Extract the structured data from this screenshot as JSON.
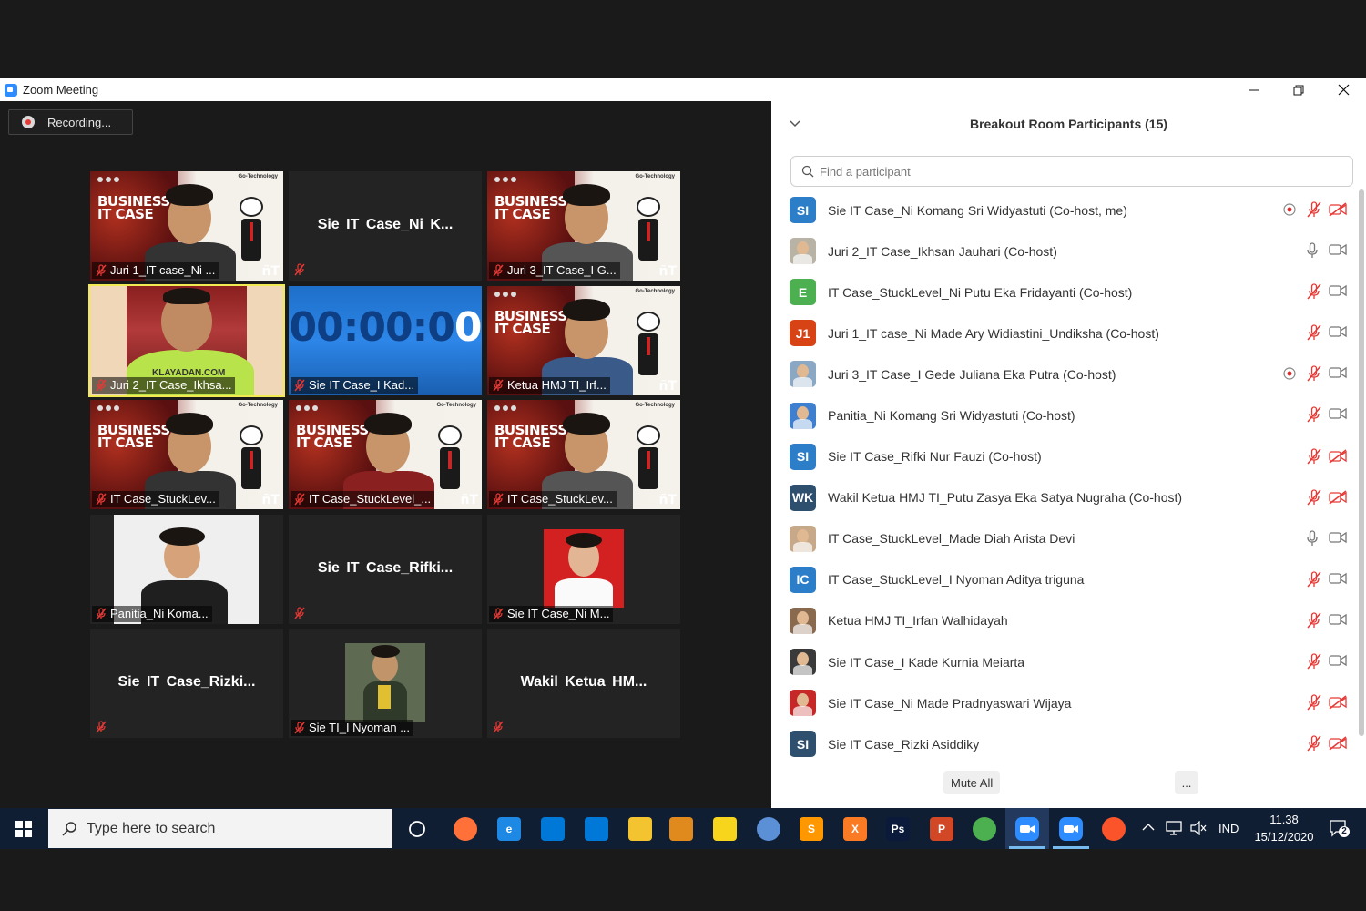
{
  "window": {
    "title": "Zoom Meeting",
    "minimize_icon": "minimize-icon",
    "restore_icon": "restore-icon",
    "close_icon": "close-icon"
  },
  "recording": {
    "label": "Recording..."
  },
  "video_tiles": [
    {
      "name": "Juri 1_IT case_Ni ...",
      "type": "business"
    },
    {
      "name": "Sie IT Case_Ni K...",
      "type": "plain"
    },
    {
      "name": "Juri 3_IT Case_I G...",
      "type": "business"
    },
    {
      "name": "Juri 2_IT Case_Ikhsa...",
      "type": "green",
      "active": true,
      "shirt_text": "KLAYADAN.COM"
    },
    {
      "name": "Sie IT Case_I Kad...",
      "type": "timer",
      "timer": "00:00:00"
    },
    {
      "name": "Ketua HMJ TI_Irf...",
      "type": "business"
    },
    {
      "name": "IT Case_StuckLev...",
      "type": "business"
    },
    {
      "name": "IT Case_StuckLevel_...",
      "type": "business"
    },
    {
      "name": "IT Case_StuckLev...",
      "type": "business"
    },
    {
      "name": "Panitia_Ni Koma...",
      "type": "photo"
    },
    {
      "name": "Sie IT Case_Rifki...",
      "type": "plain"
    },
    {
      "name": "Sie IT Case_Ni M...",
      "type": "photo"
    },
    {
      "name": "Sie IT Case_Rizki...",
      "type": "plain"
    },
    {
      "name": "Sie TI_I Nyoman ...",
      "type": "photo"
    },
    {
      "name": "Wakil Ketua HM...",
      "type": "plain"
    }
  ],
  "business_banner": {
    "line1": "BUSINESS",
    "line2": "IT CASE",
    "tagline": "Go-Technology",
    "brand": "ñT"
  },
  "panel": {
    "title": "Breakout Room Participants (15)",
    "search_placeholder": "Find a participant",
    "participants": [
      {
        "initials": "SI",
        "name": "Sie IT Case_Ni Komang Sri Widyastuti (Co-host, me)",
        "color": "#2d7ec9",
        "record": true,
        "mic": "muted",
        "video": "off"
      },
      {
        "initials": "",
        "name": "Juri 2_IT Case_Ikhsan Jauhari (Co-host)",
        "color": "#b9b3a6",
        "record": false,
        "mic": "on",
        "video": "on"
      },
      {
        "initials": "E",
        "name": "IT Case_StuckLevel_Ni Putu Eka Fridayanti (Co-host)",
        "color": "#4caf50",
        "record": false,
        "mic": "muted",
        "video": "on"
      },
      {
        "initials": "J1",
        "name": "Juri 1_IT case_Ni Made Ary Widiastini_Undiksha (Co-host)",
        "color": "#d84315",
        "record": false,
        "mic": "muted",
        "video": "on"
      },
      {
        "initials": "",
        "name": "Juri 3_IT Case_I Gede Juliana Eka Putra (Co-host)",
        "color": "#8aa7c4",
        "record": true,
        "mic": "muted",
        "video": "on"
      },
      {
        "initials": "",
        "name": "Panitia_Ni Komang Sri Widyastuti (Co-host)",
        "color": "#3f7fd0",
        "record": false,
        "mic": "muted",
        "video": "on"
      },
      {
        "initials": "SI",
        "name": "Sie IT Case_Rifki Nur Fauzi (Co-host)",
        "color": "#2d7ec9",
        "record": false,
        "mic": "muted",
        "video": "off"
      },
      {
        "initials": "WK",
        "name": "Wakil Ketua HMJ TI_Putu Zasya Eka Satya Nugraha (Co-host)",
        "color": "#2f4f6f",
        "record": false,
        "mic": "muted",
        "video": "off"
      },
      {
        "initials": "",
        "name": "IT Case_StuckLevel_Made Diah Arista Devi",
        "color": "#c7a98a",
        "record": false,
        "mic": "on",
        "video": "on"
      },
      {
        "initials": "IC",
        "name": "IT Case_StuckLevel_I Nyoman Aditya triguna",
        "color": "#2d7ec9",
        "record": false,
        "mic": "muted",
        "video": "on"
      },
      {
        "initials": "",
        "name": "Ketua HMJ TI_Irfan Walhidayah",
        "color": "#8a6a4f",
        "record": false,
        "mic": "muted",
        "video": "on"
      },
      {
        "initials": "",
        "name": "Sie IT Case_I Kade Kurnia Meiarta",
        "color": "#3a3a3a",
        "record": false,
        "mic": "muted",
        "video": "on"
      },
      {
        "initials": "",
        "name": "Sie IT Case_Ni Made Pradnyaswari Wijaya",
        "color": "#c62828",
        "record": false,
        "mic": "muted",
        "video": "off"
      },
      {
        "initials": "SI",
        "name": "Sie IT Case_Rizki Asiddiky",
        "color": "#2f4f6f",
        "record": false,
        "mic": "muted",
        "video": "off"
      }
    ],
    "mute_all_label": "Mute All",
    "more_label": "..."
  },
  "taskbar": {
    "search_placeholder": "Type here to search",
    "apps": [
      {
        "icon": "task-view-icon",
        "label": "",
        "color": "#101e33"
      },
      {
        "icon": "firefox-icon",
        "label": "",
        "color": "#ff7139"
      },
      {
        "icon": "edge-icon",
        "label": "e",
        "color": "#1e88e5"
      },
      {
        "icon": "store-icon",
        "label": "",
        "color": "#0078d7"
      },
      {
        "icon": "mail-icon",
        "label": "",
        "color": "#0078d7"
      },
      {
        "icon": "file-explorer-icon",
        "label": "",
        "color": "#f4c430"
      },
      {
        "icon": "video-player-icon",
        "label": "",
        "color": "#e08a1e"
      },
      {
        "icon": "sticky-notes-icon",
        "label": "",
        "color": "#f7d51d"
      },
      {
        "icon": "chromium-icon",
        "label": "",
        "color": "#5b8fd6"
      },
      {
        "icon": "sublime-icon",
        "label": "S",
        "color": "#ff9800"
      },
      {
        "icon": "xampp-icon",
        "label": "X",
        "color": "#fb7a24"
      },
      {
        "icon": "photoshop-icon",
        "label": "Ps",
        "color": "#0b1a3a"
      },
      {
        "icon": "powerpoint-icon",
        "label": "P",
        "color": "#d24726"
      },
      {
        "icon": "chrome-icon",
        "label": "",
        "color": "#4caf50"
      },
      {
        "icon": "zoom-icon",
        "label": "",
        "color": "#2d8cff"
      },
      {
        "icon": "zoom-meeting-icon",
        "label": "",
        "color": "#2d8cff"
      },
      {
        "icon": "brave-icon",
        "label": "",
        "color": "#fb542b"
      }
    ],
    "language": "IND",
    "time": "11.38",
    "date": "15/12/2020",
    "notification_count": "2"
  }
}
